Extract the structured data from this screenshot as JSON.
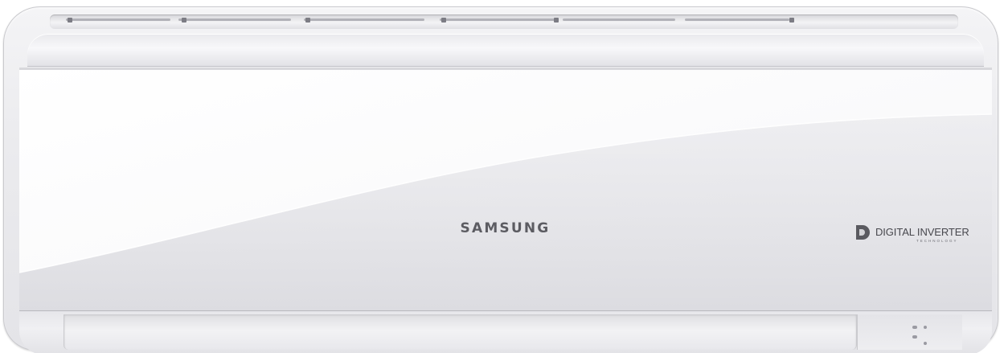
{
  "product": {
    "brand_logo_text": "SAMSUNG",
    "badge_title": "DIGITAL INVERTER",
    "badge_subtitle": "TECHNOLOGY"
  },
  "colors": {
    "body": "#ebebee",
    "panel": "#f4f4f6",
    "brand_text": "#5c5c62",
    "badge_icon": "#5a5a60"
  },
  "icons": {
    "badge_icon": "digital-inverter-logo-icon"
  }
}
